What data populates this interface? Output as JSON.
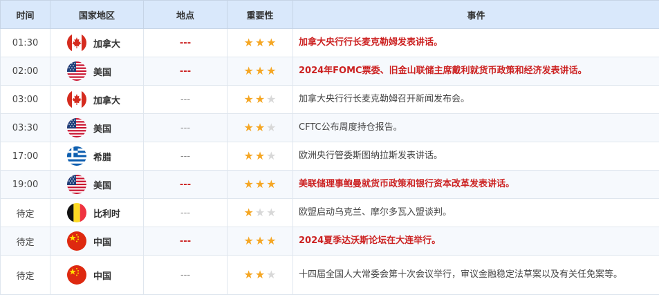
{
  "header": {
    "time": "时间",
    "country": "国家地区",
    "location": "地点",
    "importance": "重要性",
    "event": "事件"
  },
  "colors": {
    "header_bg": "#d9e8fb",
    "highlight": "#cc2222",
    "star_on": "#f5a623",
    "star_off": "#d8d8d8"
  },
  "rows": [
    {
      "time": "01:30",
      "flag": "canada-flag-icon",
      "country": "加拿大",
      "location": "---",
      "stars": 3,
      "event": "加拿大央行行长麦克勒姆发表讲话。",
      "highlight": true
    },
    {
      "time": "02:00",
      "flag": "usa-flag-icon",
      "country": "美国",
      "location": "---",
      "stars": 3,
      "event": "2024年FOMC票委、旧金山联储主席戴利就货币政策和经济发表讲话。",
      "highlight": true
    },
    {
      "time": "03:00",
      "flag": "canada-flag-icon",
      "country": "加拿大",
      "location": "---",
      "stars": 2,
      "event": "加拿大央行行长麦克勒姆召开新闻发布会。",
      "highlight": false
    },
    {
      "time": "03:30",
      "flag": "usa-flag-icon",
      "country": "美国",
      "location": "---",
      "stars": 2,
      "event": "CFTC公布周度持仓报告。",
      "highlight": false
    },
    {
      "time": "17:00",
      "flag": "greece-flag-icon",
      "country": "希腊",
      "location": "---",
      "stars": 2,
      "event": "欧洲央行管委斯图纳拉斯发表讲话。",
      "highlight": false
    },
    {
      "time": "19:00",
      "flag": "usa-flag-icon",
      "country": "美国",
      "location": "---",
      "stars": 3,
      "event": "美联储理事鲍曼就货币政策和银行资本改革发表讲话。",
      "highlight": true
    },
    {
      "time": "待定",
      "flag": "belgium-flag-icon",
      "country": "比利时",
      "location": "---",
      "stars": 1,
      "event": "欧盟启动乌克兰、摩尔多瓦入盟谈判。",
      "highlight": false
    },
    {
      "time": "待定",
      "flag": "china-flag-icon",
      "country": "中国",
      "location": "---",
      "stars": 3,
      "event": "2024夏季达沃斯论坛在大连举行。",
      "highlight": true
    },
    {
      "time": "待定",
      "flag": "china-flag-icon",
      "country": "中国",
      "location": "---",
      "stars": 2,
      "event": "十四届全国人大常委会第十次会议举行，审议金融稳定法草案以及有关任免案等。",
      "highlight": false
    }
  ]
}
